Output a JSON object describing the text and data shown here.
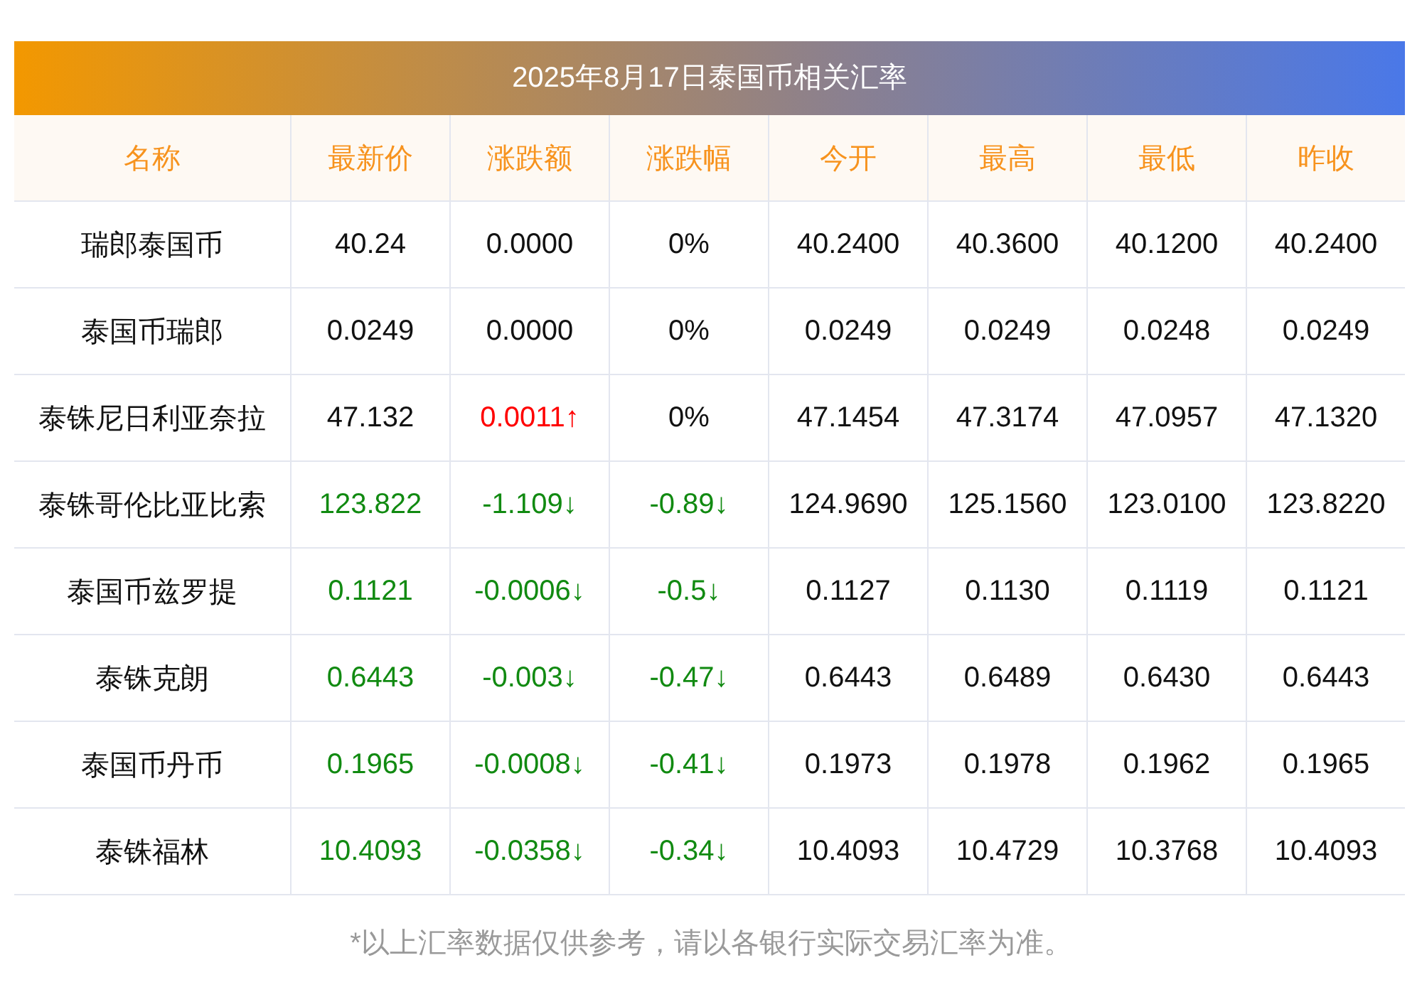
{
  "title": "2025年8月17日泰国币相关汇率",
  "table": {
    "columns": [
      "名称",
      "最新价",
      "涨跌额",
      "涨跌幅",
      "今开",
      "最高",
      "最低",
      "昨收"
    ],
    "rows": [
      [
        {
          "text": "瑞郎泰国币"
        },
        {
          "text": "40.24"
        },
        {
          "text": "0.0000"
        },
        {
          "text": "0%"
        },
        {
          "text": "40.2400"
        },
        {
          "text": "40.3600"
        },
        {
          "text": "40.1200"
        },
        {
          "text": "40.2400"
        }
      ],
      [
        {
          "text": "泰国币瑞郎"
        },
        {
          "text": "0.0249"
        },
        {
          "text": "0.0000"
        },
        {
          "text": "0%"
        },
        {
          "text": "0.0249"
        },
        {
          "text": "0.0249"
        },
        {
          "text": "0.0248"
        },
        {
          "text": "0.0249"
        }
      ],
      [
        {
          "text": "泰铢尼日利亚奈拉"
        },
        {
          "text": "47.132"
        },
        {
          "text": "0.0011↑",
          "color": "#ff0000"
        },
        {
          "text": "0%"
        },
        {
          "text": "47.1454"
        },
        {
          "text": "47.3174"
        },
        {
          "text": "47.0957"
        },
        {
          "text": "47.1320"
        }
      ],
      [
        {
          "text": "泰铢哥伦比亚比索"
        },
        {
          "text": "123.822",
          "color": "#118a11"
        },
        {
          "text": "-1.109↓",
          "color": "#118a11"
        },
        {
          "text": "-0.89↓",
          "color": "#118a11"
        },
        {
          "text": "124.9690"
        },
        {
          "text": "125.1560"
        },
        {
          "text": "123.0100"
        },
        {
          "text": "123.8220"
        }
      ],
      [
        {
          "text": "泰国币兹罗提"
        },
        {
          "text": "0.1121",
          "color": "#118a11"
        },
        {
          "text": "-0.0006↓",
          "color": "#118a11"
        },
        {
          "text": "-0.5↓",
          "color": "#118a11"
        },
        {
          "text": "0.1127"
        },
        {
          "text": "0.1130"
        },
        {
          "text": "0.1119"
        },
        {
          "text": "0.1121"
        }
      ],
      [
        {
          "text": "泰铢克朗"
        },
        {
          "text": "0.6443",
          "color": "#118a11"
        },
        {
          "text": "-0.003↓",
          "color": "#118a11"
        },
        {
          "text": "-0.47↓",
          "color": "#118a11"
        },
        {
          "text": "0.6443"
        },
        {
          "text": "0.6489"
        },
        {
          "text": "0.6430"
        },
        {
          "text": "0.6443"
        }
      ],
      [
        {
          "text": "泰国币丹币"
        },
        {
          "text": "0.1965",
          "color": "#118a11"
        },
        {
          "text": "-0.0008↓",
          "color": "#118a11"
        },
        {
          "text": "-0.41↓",
          "color": "#118a11"
        },
        {
          "text": "0.1973"
        },
        {
          "text": "0.1978"
        },
        {
          "text": "0.1962"
        },
        {
          "text": "0.1965"
        }
      ],
      [
        {
          "text": "泰铢福林"
        },
        {
          "text": "10.4093",
          "color": "#118a11"
        },
        {
          "text": "-0.0358↓",
          "color": "#118a11"
        },
        {
          "text": "-0.34↓",
          "color": "#118a11"
        },
        {
          "text": "10.4093"
        },
        {
          "text": "10.4729"
        },
        {
          "text": "10.3768"
        },
        {
          "text": "10.4093"
        }
      ]
    ]
  },
  "footnote": "*以上汇率数据仅供参考，请以各银行实际交易汇率为准。"
}
